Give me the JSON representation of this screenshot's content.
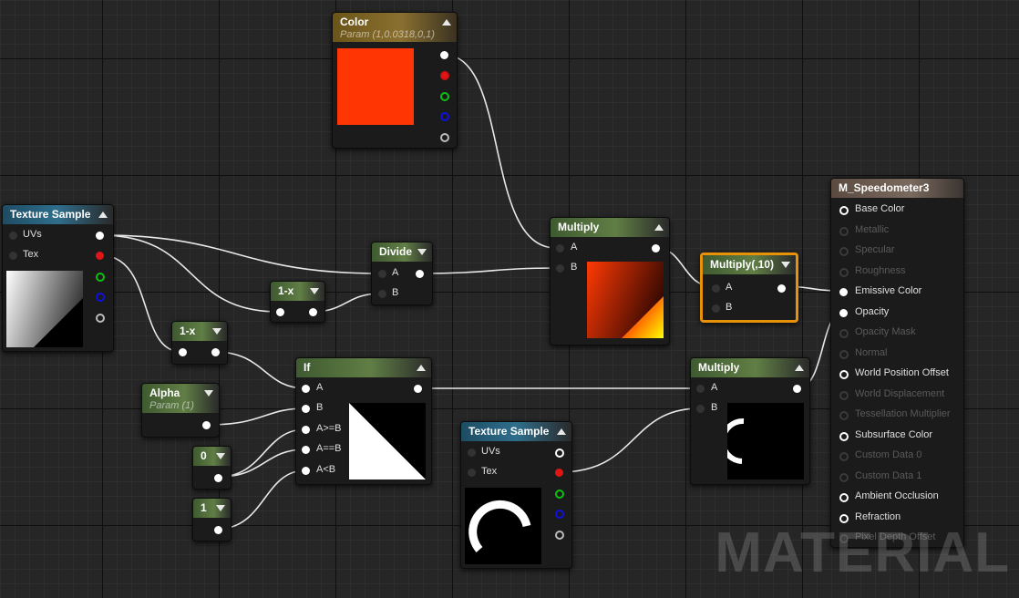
{
  "nodes": {
    "color": {
      "title": "Color",
      "subtitle": "Param (1,0.0318,0,1)",
      "swatch": "#ff3503"
    },
    "tex1": {
      "title": "Texture Sample",
      "uvs": "UVs",
      "tex": "Tex"
    },
    "oneminus1": {
      "title": "1-x"
    },
    "oneminus2": {
      "title": "1-x"
    },
    "divide": {
      "title": "Divide",
      "a": "A",
      "b": "B"
    },
    "multiply1": {
      "title": "Multiply",
      "a": "A",
      "b": "B"
    },
    "multiply10": {
      "title": "Multiply(,10)",
      "a": "A",
      "b": "B"
    },
    "alpha": {
      "title": "Alpha",
      "subtitle": "Param (1)"
    },
    "const0": {
      "title": "0"
    },
    "const1": {
      "title": "1"
    },
    "ifnode": {
      "title": "If",
      "a": "A",
      "b": "B",
      "ge": "A>=B",
      "eq": "A==B",
      "lt": "A<B"
    },
    "tex2": {
      "title": "Texture Sample",
      "uvs": "UVs",
      "tex": "Tex"
    },
    "multiply2": {
      "title": "Multiply",
      "a": "A",
      "b": "B"
    }
  },
  "material": {
    "title": "M_Speedometer3",
    "inputs": [
      {
        "label": "Base Color",
        "active": true
      },
      {
        "label": "Metallic",
        "active": false
      },
      {
        "label": "Specular",
        "active": false
      },
      {
        "label": "Roughness",
        "active": false
      },
      {
        "label": "Emissive Color",
        "active": true
      },
      {
        "label": "Opacity",
        "active": true
      },
      {
        "label": "Opacity Mask",
        "active": false
      },
      {
        "label": "Normal",
        "active": false
      },
      {
        "label": "World Position Offset",
        "active": true
      },
      {
        "label": "World Displacement",
        "active": false
      },
      {
        "label": "Tessellation Multiplier",
        "active": false
      },
      {
        "label": "Subsurface Color",
        "active": true
      },
      {
        "label": "Custom Data 0",
        "active": false
      },
      {
        "label": "Custom Data 1",
        "active": false
      },
      {
        "label": "Ambient Occlusion",
        "active": true
      },
      {
        "label": "Refraction",
        "active": true
      },
      {
        "label": "Pixel Depth Offset",
        "active": false
      }
    ]
  },
  "watermark": "MATERIAL"
}
